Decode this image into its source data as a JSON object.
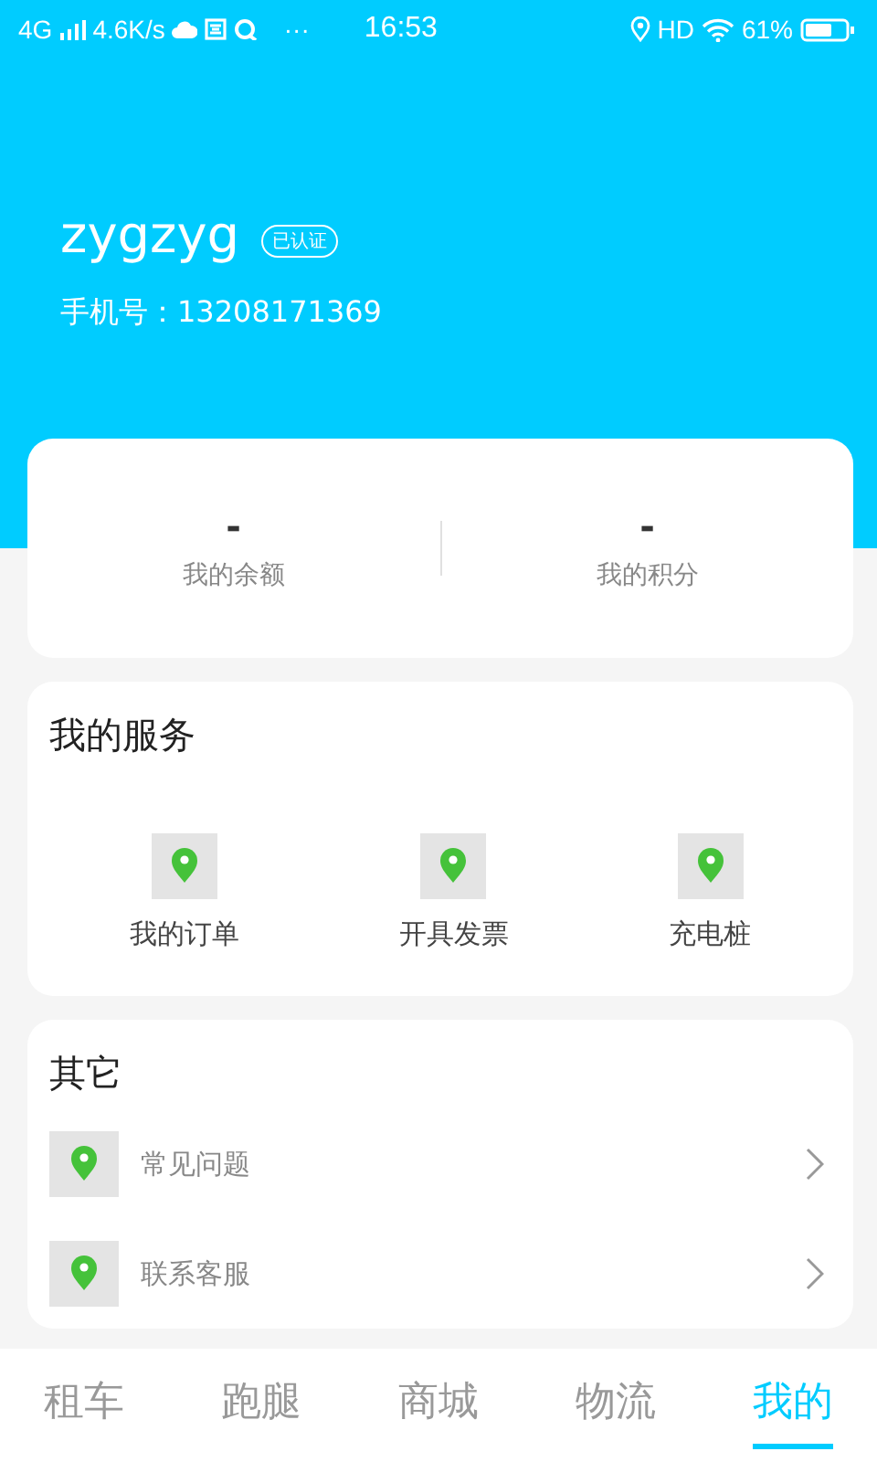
{
  "status_bar": {
    "network": "4G",
    "speed": "4.6K/s",
    "more": "···",
    "time": "16:53",
    "hd": "HD",
    "battery": "61%"
  },
  "profile": {
    "username": "zygzyg",
    "badge": "已认证",
    "phone": "手机号：13208171369"
  },
  "stats": [
    {
      "value": "-",
      "label": "我的余额"
    },
    {
      "value": "-",
      "label": "我的积分"
    }
  ],
  "services": {
    "title": "我的服务",
    "items": [
      "我的订单",
      "开具发票",
      "充电桩"
    ]
  },
  "other": {
    "title": "其它",
    "items": [
      "常见问题",
      "联系客服"
    ]
  },
  "tabs": [
    {
      "label": "租车",
      "selected": false
    },
    {
      "label": "跑腿",
      "selected": false
    },
    {
      "label": "商城",
      "selected": false
    },
    {
      "label": "物流",
      "selected": false
    },
    {
      "label": "我的",
      "selected": true
    }
  ]
}
